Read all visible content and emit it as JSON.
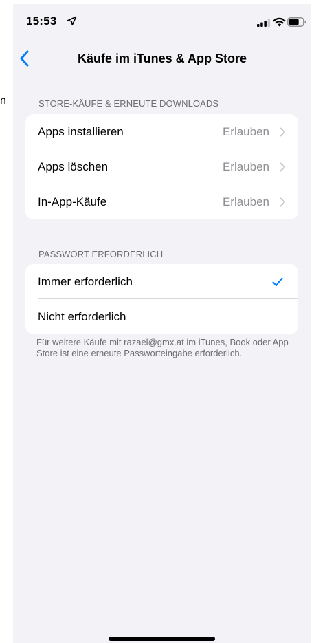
{
  "left_edge_text": "n",
  "status_bar": {
    "time": "15:53",
    "icons": [
      "location-arrow-icon",
      "cellular-signal-icon",
      "wifi-icon",
      "battery-icon"
    ]
  },
  "nav": {
    "back_icon": "chevron-left-icon",
    "title": "Käufe im iTunes & App Store"
  },
  "sections": {
    "store": {
      "header": "STORE-KÄUFE & ERNEUTE DOWNLOADS",
      "rows": [
        {
          "label": "Apps installieren",
          "value": "Erlauben"
        },
        {
          "label": "Apps löschen",
          "value": "Erlauben"
        },
        {
          "label": "In-App-Käufe",
          "value": "Erlauben"
        }
      ]
    },
    "password": {
      "header": "PASSWORT ERFORDERLICH",
      "rows": [
        {
          "label": "Immer erforderlich",
          "checked": true
        },
        {
          "label": "Nicht erforderlich",
          "checked": false
        }
      ],
      "footer": "Für weitere Käufe mit razael@gmx.at im iTunes, Book oder App Store ist eine erneute Passworteingabe erforderlich."
    }
  },
  "colors": {
    "accent": "#007aff",
    "background": "#f2f2f7",
    "secondary_text": "#8e8e93",
    "header_text": "#6d6d72"
  }
}
